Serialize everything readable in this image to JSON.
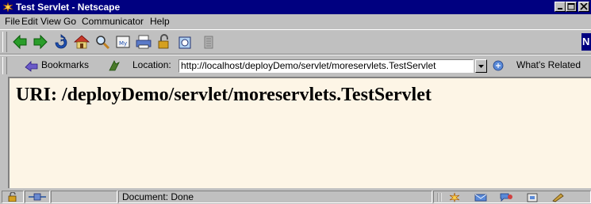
{
  "window": {
    "title": "Test Servlet - Netscape"
  },
  "menu": {
    "items": [
      {
        "label": "File"
      },
      {
        "label": "Edit"
      },
      {
        "label": "View"
      },
      {
        "label": "Go"
      },
      {
        "label": "Communicator"
      },
      {
        "label": "Help"
      }
    ]
  },
  "toolbar": {
    "buttons": [
      {
        "icon": "back-icon"
      },
      {
        "icon": "forward-icon"
      },
      {
        "icon": "reload-icon"
      },
      {
        "icon": "home-icon"
      },
      {
        "icon": "search-icon"
      },
      {
        "icon": "guide-icon"
      },
      {
        "icon": "print-icon"
      },
      {
        "icon": "security-icon"
      },
      {
        "icon": "shop-icon"
      },
      {
        "icon": "stop-icon"
      }
    ]
  },
  "location_bar": {
    "bookmarks_label": "Bookmarks",
    "location_label": "Location:",
    "url": "http://localhost/deployDemo/servlet/moreservlets.TestServlet",
    "whats_related_label": "What's Related"
  },
  "page": {
    "heading": "URI: /deployDemo/servlet/moreservlets.TestServlet"
  },
  "status_bar": {
    "status_text": "Document: Done"
  },
  "colors": {
    "title_bar": "#000080",
    "content_background": "#fdf5e6",
    "chrome": "#c0c0c0"
  }
}
